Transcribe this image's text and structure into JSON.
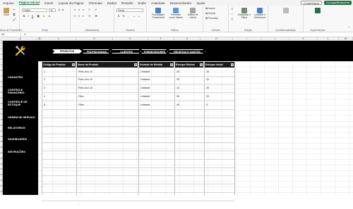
{
  "menu": {
    "items": [
      "Arquivo",
      "Página Inicial",
      "Inserir",
      "Layout da Página",
      "Fórmulas",
      "Dados",
      "Revisão",
      "Exibir",
      "Automate",
      "Desenvolvedor",
      "Ajuda"
    ],
    "active_index": 1,
    "comments_label": "Comentários",
    "share_label": "Compartilhamento"
  },
  "ribbon": {
    "clipboard": {
      "label": "Área de Transferên...",
      "paste": "Colar"
    },
    "font": {
      "label": "Fonte",
      "font_name": "Calibri",
      "font_size": "11",
      "bold": "N",
      "italic": "I",
      "underline": "S"
    },
    "alignment": {
      "label": "Alinhamento"
    },
    "number": {
      "label": "Número",
      "format": "Geral",
      "currency": "$",
      "percent": "%"
    },
    "styles": {
      "label": "Estilos",
      "cond_format": "Formatação Condicional",
      "format_table": "Formatar como Tabela",
      "cell_styles": "Estilos de Célula"
    },
    "cells": {
      "label": "Células",
      "insert": "Inserir",
      "delete": "Excluir",
      "format": "Formatar"
    },
    "editing": {
      "label": "Edição",
      "sort_filter": "Classificar e Filtrar",
      "find_select": "Localizar e Selecionar"
    },
    "sensitivity": {
      "label": "Confidencialidade"
    },
    "addins": {
      "label": "Suplementos",
      "addins_btn": "Suplementos"
    }
  },
  "formula_bar": {
    "name_box": "A1",
    "fx": "fx",
    "value": ""
  },
  "columns": [
    "A",
    "B",
    "C",
    "D",
    "E",
    "F",
    "G",
    "H",
    "I",
    "J",
    "K",
    "L",
    "M"
  ],
  "rows": [
    "1",
    "2",
    "3",
    "4",
    "5",
    "6",
    "7",
    "8",
    "9",
    "10",
    "11",
    "12",
    "13",
    "14",
    "15",
    "16",
    "17",
    "18",
    "19",
    "20",
    "21",
    "22",
    "23",
    "24",
    "25",
    "26",
    "27",
    "28"
  ],
  "sidebar": {
    "items": [
      "CADASTRO",
      "CONTROLE FINANCEIRO",
      "CONTROLE DE ESTOQUE",
      "ORDEM DE SERVIÇO",
      "RELATÓRIOS",
      "DASHBOARDS",
      "INSTRUÇÕES"
    ],
    "logo_icon": "wrench-icon"
  },
  "nav_tabs": [
    "PRODUTOS",
    "PROFISSIONAIS",
    "CLIENTES",
    "FORNECEDORES",
    "RECEITAS E GASTOS"
  ],
  "nav_active": 0,
  "table": {
    "headers": [
      "Código do Produto",
      "Nome do Produto",
      "Unidade de Medida",
      "Estoque Mínimo",
      "Estoque Inicial"
    ],
    "rows": [
      [
        "1",
        "Pneu Aro 14",
        "Unidade",
        "30",
        "20"
      ],
      [
        "2",
        "Pneu Aro 15",
        "Unidade",
        "25",
        "20"
      ],
      [
        "3",
        "Pneu Aro 16",
        "Unidade",
        "10",
        "20"
      ],
      [
        "4",
        "Óleo",
        "Unidade",
        "50",
        "20"
      ],
      [
        "5",
        "Filtro",
        "Unidade",
        "40",
        "0"
      ],
      [
        "",
        "-",
        "",
        "",
        ""
      ],
      [
        "",
        "-",
        "",
        "",
        ""
      ],
      [
        "",
        "-",
        "",
        "",
        ""
      ],
      [
        "",
        "-",
        "",
        "",
        ""
      ],
      [
        "",
        "-",
        "",
        "",
        ""
      ],
      [
        "",
        "-",
        "",
        "",
        ""
      ],
      [
        "",
        "-",
        "",
        "",
        ""
      ],
      [
        "",
        "-",
        "",
        "",
        ""
      ],
      [
        "",
        "-",
        "",
        "",
        ""
      ],
      [
        "",
        "-",
        "",
        "",
        ""
      ],
      [
        "",
        "-",
        "",
        "",
        ""
      ],
      [
        "",
        "-",
        "",
        "",
        ""
      ]
    ]
  },
  "colors": {
    "excel_green": "#217346",
    "dark": "#000000",
    "header_dark": "#1a1a1a"
  }
}
